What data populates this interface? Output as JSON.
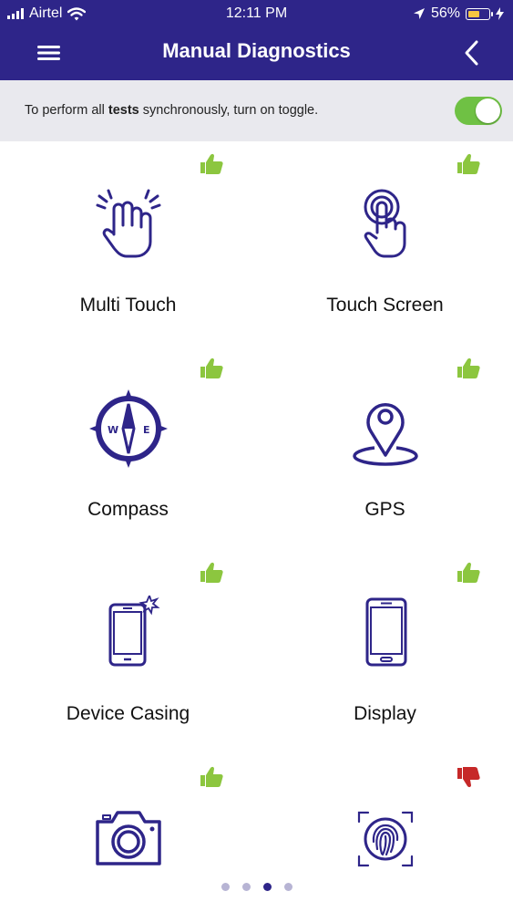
{
  "status_bar": {
    "carrier": "Airtel",
    "time": "12:11 PM",
    "battery": "56%"
  },
  "header": {
    "title": "Manual Diagnostics"
  },
  "toggle_row": {
    "text_before": "To perform all ",
    "text_bold": "tests",
    "text_after": " synchronously, turn on toggle.",
    "toggle_on": true
  },
  "tests": [
    {
      "label": "Multi Touch",
      "icon": "multi-touch-icon",
      "result": "pass"
    },
    {
      "label": "Touch Screen",
      "icon": "touch-screen-icon",
      "result": "pass"
    },
    {
      "label": "Compass",
      "icon": "compass-icon",
      "result": "pass"
    },
    {
      "label": "GPS",
      "icon": "gps-pin-icon",
      "result": "pass"
    },
    {
      "label": "Device Casing",
      "icon": "device-casing-icon",
      "result": "pass"
    },
    {
      "label": "Display",
      "icon": "display-icon",
      "result": "pass"
    },
    {
      "label": "",
      "icon": "camera-icon",
      "result": "pass"
    },
    {
      "label": "",
      "icon": "fingerprint-icon",
      "result": "fail"
    }
  ],
  "compass_letters": {
    "west": "W",
    "east": "E"
  },
  "pagination": {
    "count": 4,
    "active": 3
  },
  "colors": {
    "primary": "#2e2589",
    "pass": "#8cc63f",
    "fail": "#c62828",
    "toggle_on": "#6fc144"
  }
}
